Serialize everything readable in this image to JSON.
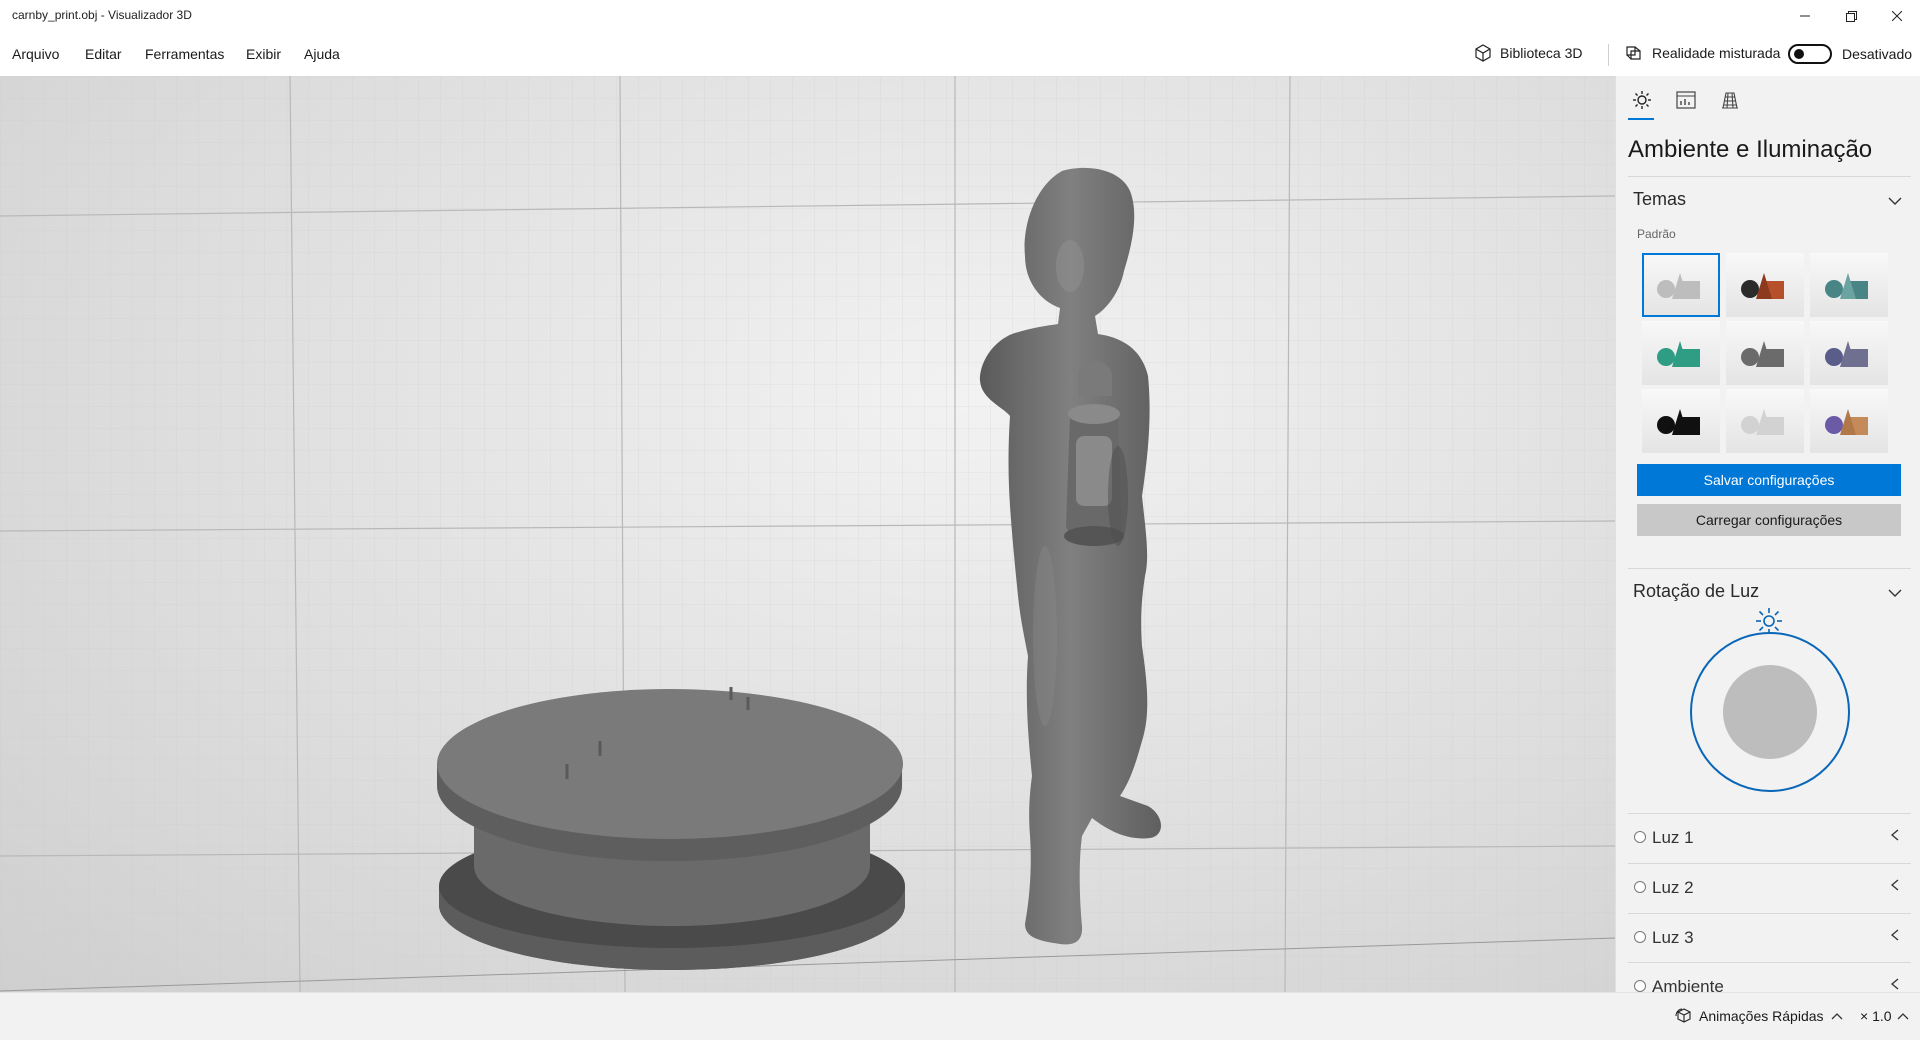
{
  "window": {
    "title": "carnby_print.obj - Visualizador 3D",
    "minimize_icon": "minimize-icon",
    "restore_icon": "restore-icon",
    "close_icon": "close-icon"
  },
  "menu": {
    "items": [
      "Arquivo",
      "Editar",
      "Ferramentas",
      "Exibir",
      "Ajuda"
    ]
  },
  "toolbar": {
    "library_label": "Biblioteca 3D",
    "mixed_reality_label": "Realidade misturada",
    "toggle_state": "Desativado",
    "toggle_on": false
  },
  "panel": {
    "tabs": [
      "sun-icon",
      "stats-icon",
      "grid-icon"
    ],
    "title": "Ambiente e Iluminação",
    "themes_section": "Temas",
    "themes_sublabel": "Padrão",
    "themes": [
      {
        "selected": true,
        "colors": [
          "#bdbdbd",
          "#bdbdbd",
          "#bdbdbd"
        ]
      },
      {
        "selected": false,
        "colors": [
          "#2b2b2b",
          "#b5502a",
          "#8c3a1e"
        ]
      },
      {
        "selected": false,
        "colors": [
          "#4a8585",
          "#4a8585",
          "#6aa3a0"
        ]
      },
      {
        "selected": false,
        "colors": [
          "#2f9c84",
          "#2f9c84",
          "#2f9c84"
        ]
      },
      {
        "selected": false,
        "colors": [
          "#6b6b6b",
          "#6b6b6b",
          "#6b6b6b"
        ]
      },
      {
        "selected": false,
        "colors": [
          "#5a5c8a",
          "#6f7090",
          "#6f7090"
        ]
      },
      {
        "selected": false,
        "colors": [
          "#101010",
          "#101010",
          "#101010"
        ]
      },
      {
        "selected": false,
        "colors": [
          "#d2d2d2",
          "#d2d2d2",
          "#d2d2d2"
        ]
      },
      {
        "selected": false,
        "colors": [
          "#6b5aa5",
          "#c48a5a",
          "#b07848"
        ]
      }
    ],
    "save_button": "Salvar configurações",
    "load_button": "Carregar configurações",
    "light_rotation_section": "Rotação de Luz",
    "lights": [
      "Luz 1",
      "Luz 2",
      "Luz 3",
      "Ambiente"
    ]
  },
  "status": {
    "animations_label": "Animações Rápidas",
    "speed": "× 1.0"
  },
  "colors": {
    "accent": "#0078d7",
    "model_gray": "#6e6e6e"
  }
}
